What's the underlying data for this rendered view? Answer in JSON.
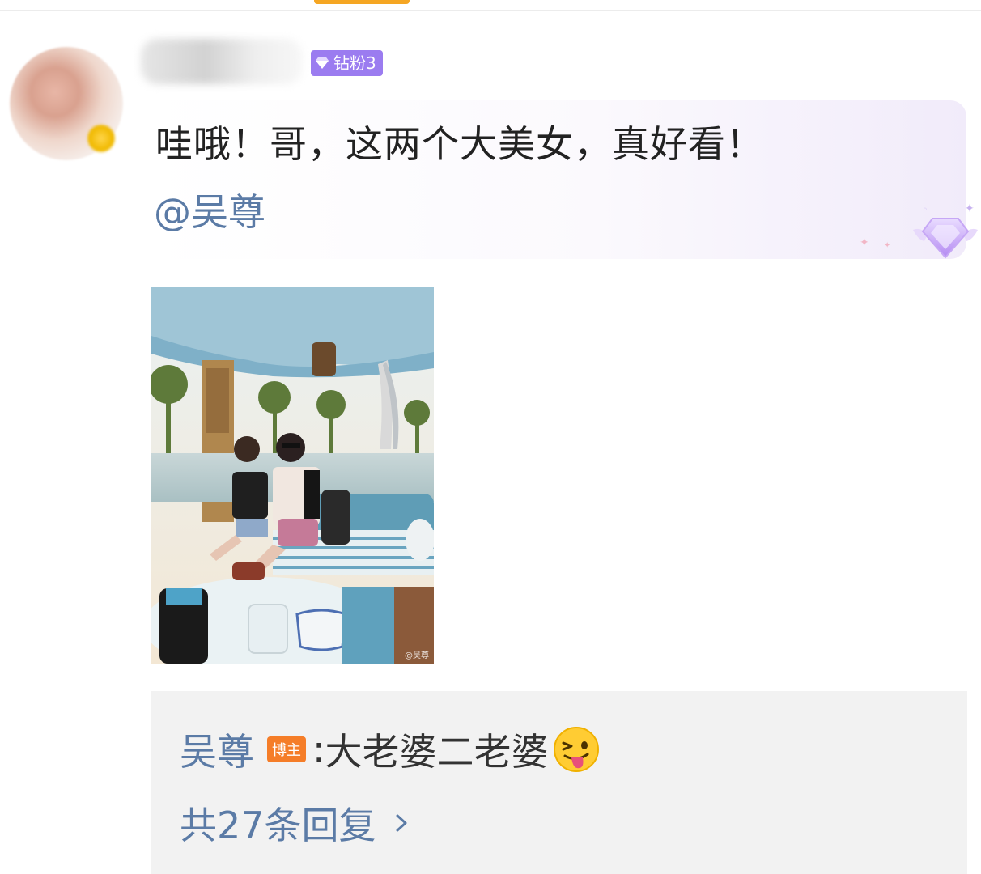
{
  "comment": {
    "fan_badge": {
      "label": "钻粉3",
      "color": "#9b7cf0",
      "icon": "diamond-icon"
    },
    "text": "哇哦！哥，这两个大美女，真好看！",
    "mention": "@吴尊",
    "mention_color": "#5b7ba6"
  },
  "photo": {
    "watermark": "@吴尊"
  },
  "reply": {
    "author": "吴尊",
    "author_badge": "博主",
    "author_badge_color": "#f57d28",
    "separator": ":",
    "text": "大老婆二老婆",
    "emoji": "winking-tongue-emoji",
    "count_label": "共27条回复",
    "count_icon": "chevron-right-icon"
  }
}
